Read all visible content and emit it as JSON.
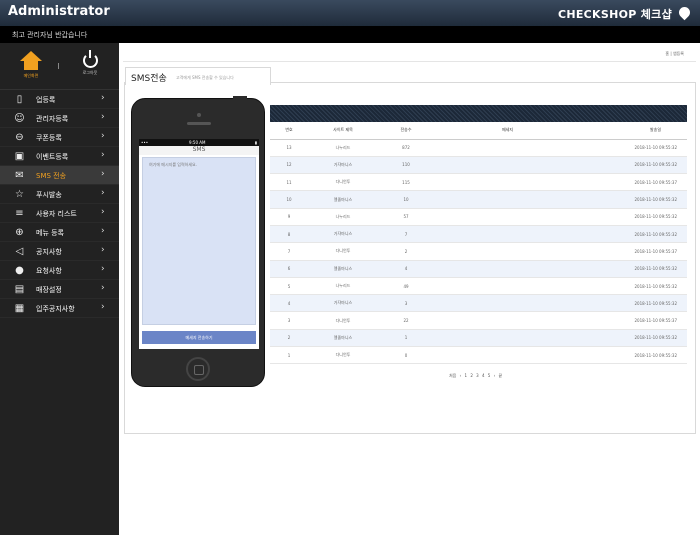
{
  "header": {
    "title": "Administrator",
    "brand": "CHECKSHOP 체크샵"
  },
  "subbar": {
    "text": "최고 관리자님 반갑습니다"
  },
  "sidebar": {
    "home_label": "메인화면",
    "logout_label": "로그아웃",
    "items": [
      {
        "label": "업등록",
        "icon": "phone-icon"
      },
      {
        "label": "관리자등록",
        "icon": "user-icon"
      },
      {
        "label": "쿠폰등록",
        "icon": "coupon-icon"
      },
      {
        "label": "이벤트등록",
        "icon": "gift-icon"
      },
      {
        "label": "SMS 전송",
        "icon": "mail-icon",
        "active": true
      },
      {
        "label": "푸시발송",
        "icon": "star-icon"
      },
      {
        "label": "사용자 리스트",
        "icon": "list-icon"
      },
      {
        "label": "메뉴 등록",
        "icon": "plus-icon"
      },
      {
        "label": "공지사항",
        "icon": "megaphone-icon"
      },
      {
        "label": "요청사항",
        "icon": "chat-icon"
      },
      {
        "label": "매장설정",
        "icon": "calendar-icon"
      },
      {
        "label": "입주공지사항",
        "icon": "notice-icon"
      }
    ]
  },
  "breadcrumb": "홈 | 앱등록",
  "tab": {
    "title": "SMS전송",
    "desc": "고객에게 SMS 전송할 수 있습니다"
  },
  "phone": {
    "time": "9:50 AM",
    "screen_title": "SMS",
    "placeholder": "여기에 메시지를 입력하세요.",
    "send_label": "메세지 전송하기"
  },
  "table": {
    "headers": [
      "번호",
      "사이트 제목",
      "전송수",
      "메세지",
      "발송일"
    ],
    "rows": [
      [
        "13",
        "나누리드",
        "872",
        "",
        "2018-11-10 09:55:32"
      ],
      [
        "12",
        "가쟈마니스",
        "110",
        "",
        "2018-11-10 09:55:32"
      ],
      [
        "11",
        "다니언투",
        "115",
        "",
        "2018-11-10 09:55:37"
      ],
      [
        "10",
        "엘졸마니스",
        "10",
        "",
        "2018-11-10 09:55:32"
      ],
      [
        "9",
        "나누리드",
        "57",
        "",
        "2018-11-10 09:55:32"
      ],
      [
        "8",
        "가쟈마니스",
        "7",
        "",
        "2018-11-10 09:55:32"
      ],
      [
        "7",
        "다니언투",
        "2",
        "",
        "2018-11-10 09:55:37"
      ],
      [
        "6",
        "엘졸마니스",
        "4",
        "",
        "2018-11-10 09:55:32"
      ],
      [
        "5",
        "나누리드",
        "49",
        "",
        "2018-11-10 09:55:32"
      ],
      [
        "4",
        "가쟈마니스",
        "3",
        "",
        "2018-11-10 09:55:32"
      ],
      [
        "3",
        "다니언투",
        "22",
        "",
        "2018-11-10 09:55:37"
      ],
      [
        "2",
        "엘졸마니스",
        "1",
        "",
        "2018-11-10 09:55:32"
      ],
      [
        "1",
        "다니언투",
        "0",
        "",
        "2018-11-10 09:55:32"
      ]
    ]
  },
  "pager": {
    "text": "처음 ‹ 1 2 3 4 5 › 끝"
  }
}
